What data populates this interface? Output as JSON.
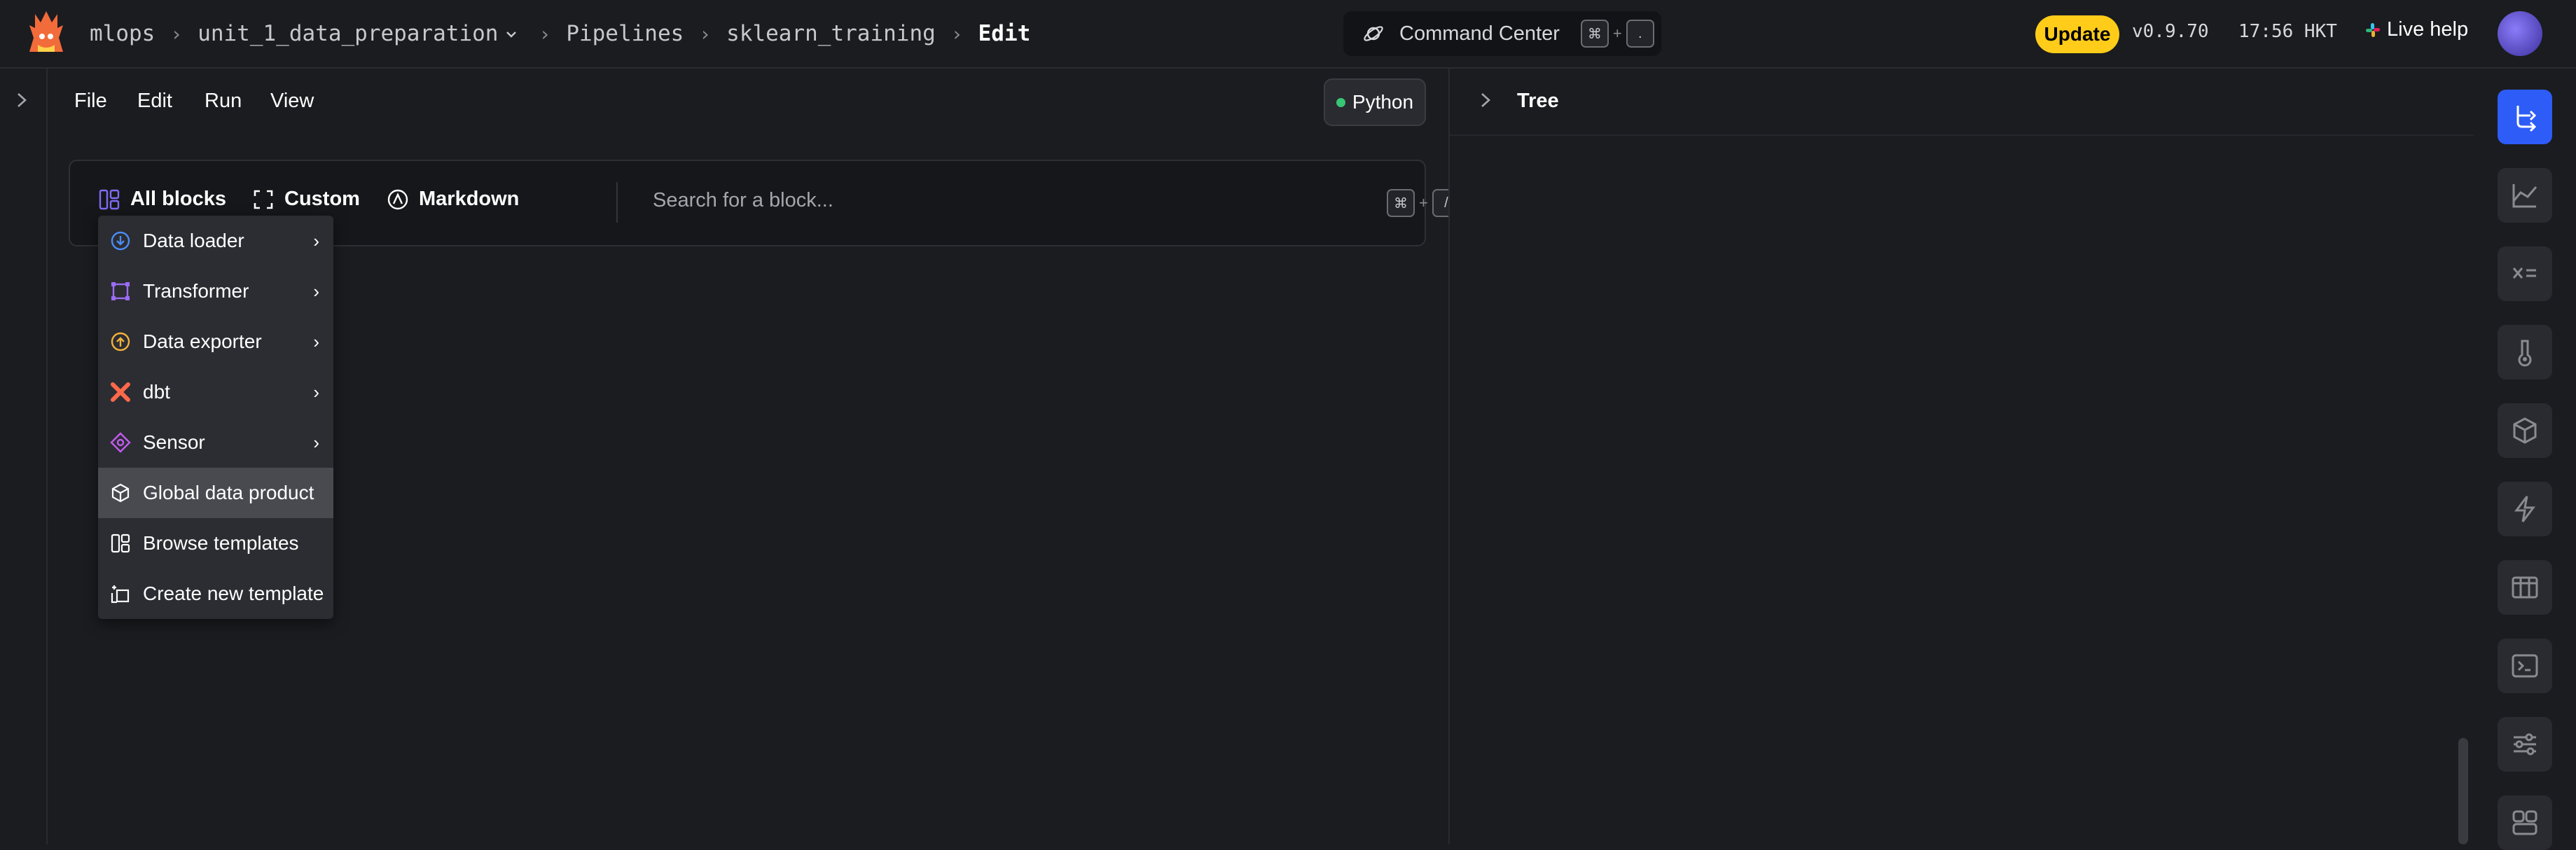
{
  "header": {
    "breadcrumbs": [
      "mlops",
      "unit_1_data_preparation",
      "Pipelines",
      "sklearn_training",
      "Edit"
    ],
    "command_center": {
      "label": "Command Center",
      "key1": "⌘",
      "plus": "+",
      "key2": "."
    },
    "update_label": "Update",
    "version": "v0.9.70",
    "time": "17:56 HKT",
    "live_help": "Live help"
  },
  "menubar": {
    "items": [
      "File",
      "Edit",
      "Run",
      "View"
    ],
    "kernel": "Python",
    "kernel_status_color": "#37c674"
  },
  "block_bar": {
    "all_blocks": "All blocks",
    "custom": "Custom",
    "markdown": "Markdown",
    "search_placeholder": "Search for a block...",
    "shortcut": {
      "key1": "⌘",
      "plus": "+",
      "key2": "/"
    }
  },
  "block_menu": {
    "items": [
      {
        "label": "Data loader",
        "icon": "download-circle-icon",
        "submenu": true
      },
      {
        "label": "Transformer",
        "icon": "transform-square-icon",
        "submenu": true
      },
      {
        "label": "Data exporter",
        "icon": "upload-circle-icon",
        "submenu": true
      },
      {
        "label": "dbt",
        "icon": "dbt-icon",
        "submenu": true
      },
      {
        "label": "Sensor",
        "icon": "sensor-icon",
        "submenu": true
      },
      {
        "label": "Global data product",
        "icon": "cube-icon",
        "submenu": false,
        "active": true
      },
      {
        "label": "Browse templates",
        "icon": "templates-icon",
        "submenu": false
      },
      {
        "label": "Create new template",
        "icon": "new-template-icon",
        "submenu": false
      }
    ]
  },
  "right_panel": {
    "title": "Tree"
  },
  "sidebar": {
    "buttons": [
      "tree-icon",
      "chart-icon",
      "variables-icon",
      "thermometer-icon",
      "cube-icon",
      "lightning-icon",
      "table-icon",
      "terminal-icon",
      "settings-sliders-icon",
      "blocks-icon"
    ],
    "active_color": "#2e5cf6"
  },
  "colors": {
    "background": "#1b1c20",
    "update": "#ffcc19",
    "accent_blue": "#2e5cf6"
  }
}
